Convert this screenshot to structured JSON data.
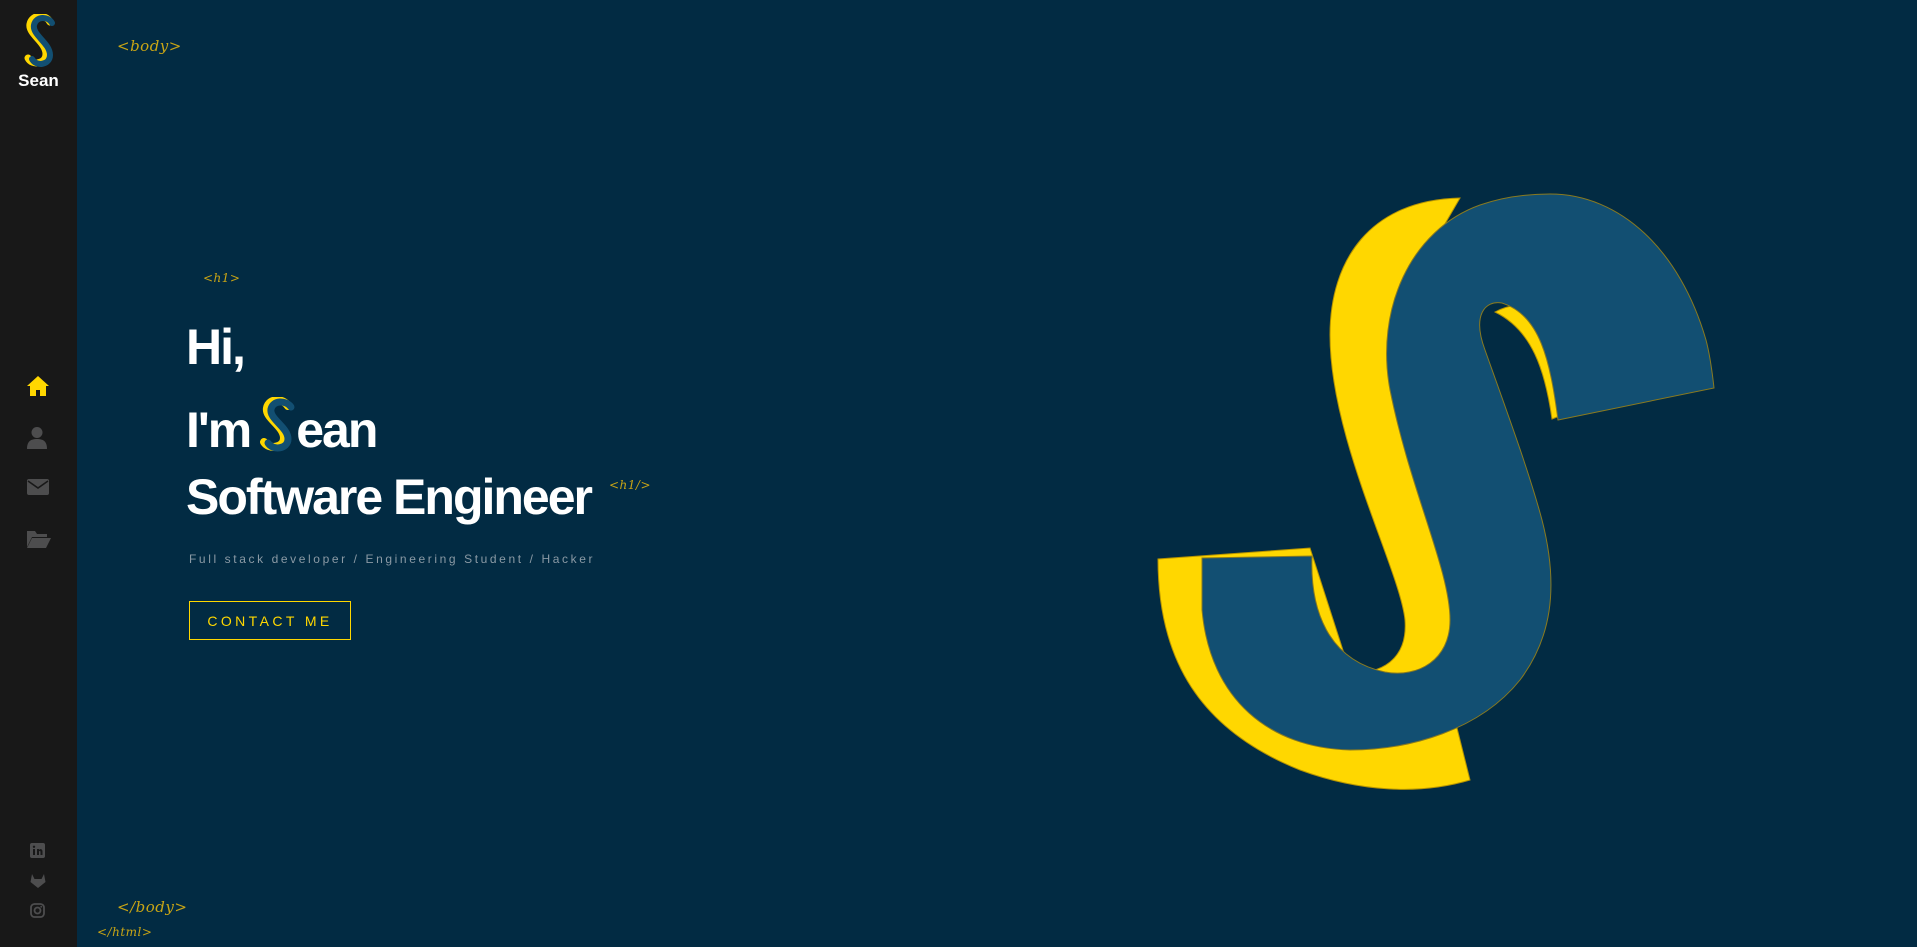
{
  "brand": {
    "name": "Sean",
    "logo_icon": "s-logo-icon"
  },
  "colors": {
    "background": "#022b43",
    "sidebar": "#181818",
    "accent": "#ffd700",
    "logo_blue": "#124f72",
    "nav_inactive": "#4d4d4e",
    "tag": "#c9a515"
  },
  "nav": {
    "items": [
      {
        "icon": "home-icon",
        "active": true
      },
      {
        "icon": "user-icon",
        "active": false
      },
      {
        "icon": "envelope-icon",
        "active": false
      },
      {
        "icon": "folder-open-icon",
        "active": false
      }
    ]
  },
  "social": {
    "items": [
      {
        "icon": "linkedin-icon"
      },
      {
        "icon": "gitlab-icon"
      },
      {
        "icon": "instagram-icon"
      }
    ]
  },
  "tags": {
    "body_open": "<body>",
    "h1_open": "<h1>",
    "h1_close": "<h1/>",
    "body_close": "</body>",
    "html_close": "</html>"
  },
  "hero": {
    "line1": "Hi,",
    "line2_prefix": "I'm",
    "line2_suffix": "ean",
    "line3": "Software Engineer",
    "subtitle": "Full stack developer / Engineering Student / Hacker",
    "contact_label": "CONTACT ME"
  }
}
